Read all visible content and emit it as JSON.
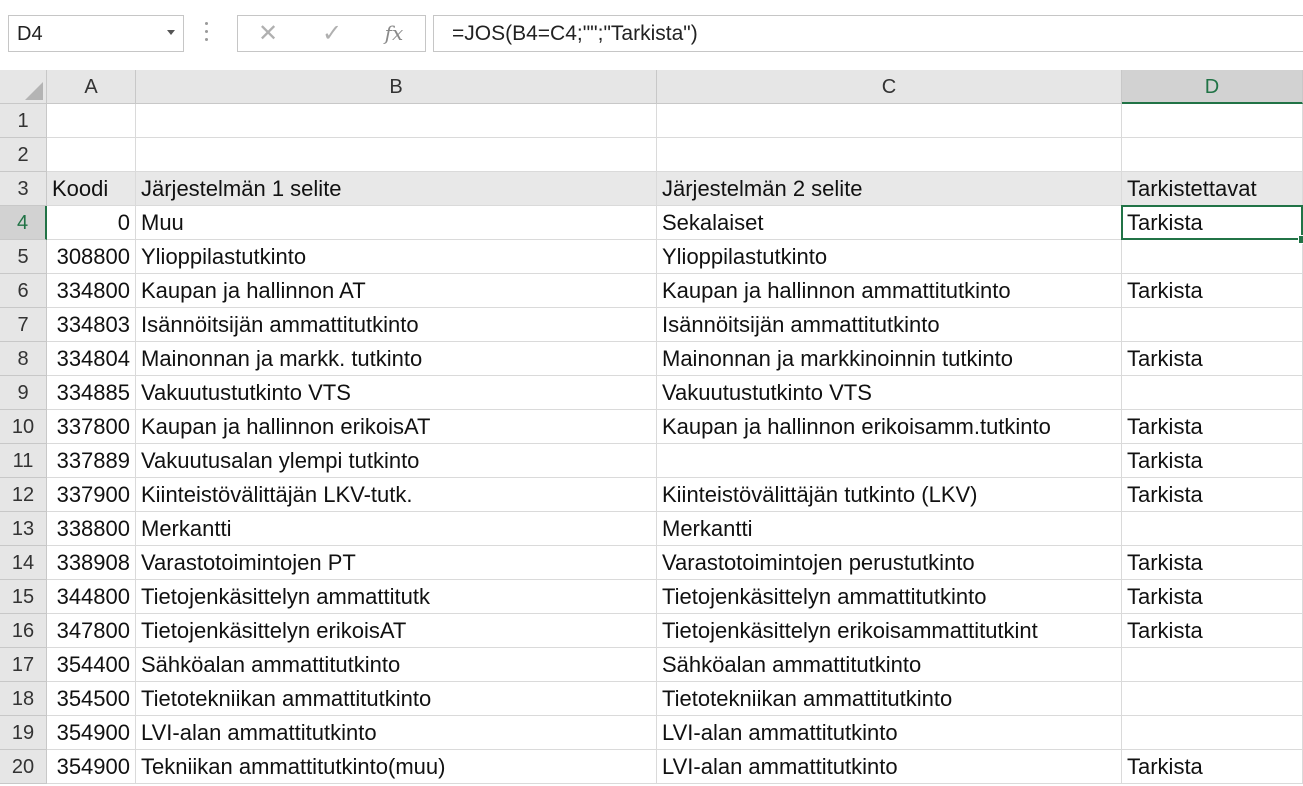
{
  "formula_bar": {
    "name_box": "D4",
    "cancel_glyph": "✕",
    "enter_glyph": "✓",
    "fx_label": "fx",
    "formula": "=JOS(B4=C4;\"\";\"Tarkista\")"
  },
  "columns": [
    "A",
    "B",
    "C",
    "D"
  ],
  "active_cell": {
    "column": "D",
    "row": 4
  },
  "rows": [
    {
      "n": "1",
      "a": "",
      "b": "",
      "c": "",
      "d": ""
    },
    {
      "n": "2",
      "a": "",
      "b": "",
      "c": "",
      "d": ""
    },
    {
      "n": "3",
      "a": "Koodi",
      "b": "Järjestelmän 1 selite",
      "c": "Järjestelmän 2 selite",
      "d": "Tarkistettavat",
      "header": true
    },
    {
      "n": "4",
      "a": "0",
      "b": "Muu",
      "c": "Sekalaiset",
      "d": "Tarkista"
    },
    {
      "n": "5",
      "a": "308800",
      "b": "Ylioppilastutkinto",
      "c": "Ylioppilastutkinto",
      "d": ""
    },
    {
      "n": "6",
      "a": "334800",
      "b": "Kaupan ja hallinnon AT",
      "c": "Kaupan ja hallinnon ammattitutkinto",
      "d": "Tarkista"
    },
    {
      "n": "7",
      "a": "334803",
      "b": "Isännöitsijän ammattitutkinto",
      "c": "Isännöitsijän ammattitutkinto",
      "d": ""
    },
    {
      "n": "8",
      "a": "334804",
      "b": "Mainonnan ja markk. tutkinto",
      "c": "Mainonnan ja markkinoinnin tutkinto",
      "d": "Tarkista"
    },
    {
      "n": "9",
      "a": "334885",
      "b": "Vakuutustutkinto VTS",
      "c": "Vakuutustutkinto VTS",
      "d": ""
    },
    {
      "n": "10",
      "a": "337800",
      "b": "Kaupan ja hallinnon erikoisAT",
      "c": "Kaupan ja hallinnon erikoisamm.tutkinto",
      "d": "Tarkista"
    },
    {
      "n": "11",
      "a": "337889",
      "b": "Vakuutusalan ylempi tutkinto",
      "c": "",
      "d": "Tarkista"
    },
    {
      "n": "12",
      "a": "337900",
      "b": "Kiinteistövälittäjän LKV-tutk.",
      "c": "Kiinteistövälittäjän tutkinto (LKV)",
      "d": "Tarkista"
    },
    {
      "n": "13",
      "a": "338800",
      "b": "Merkantti",
      "c": "Merkantti",
      "d": ""
    },
    {
      "n": "14",
      "a": "338908",
      "b": "Varastotoimintojen PT",
      "c": "Varastotoimintojen perustutkinto",
      "d": "Tarkista"
    },
    {
      "n": "15",
      "a": "344800",
      "b": "Tietojenkäsittelyn ammattitutk",
      "c": "Tietojenkäsittelyn ammattitutkinto",
      "d": "Tarkista"
    },
    {
      "n": "16",
      "a": "347800",
      "b": "Tietojenkäsittelyn erikoisAT",
      "c": "Tietojenkäsittelyn erikoisammattitutkint",
      "d": "Tarkista"
    },
    {
      "n": "17",
      "a": "354400",
      "b": "Sähköalan ammattitutkinto",
      "c": "Sähköalan ammattitutkinto",
      "d": ""
    },
    {
      "n": "18",
      "a": "354500",
      "b": "Tietotekniikan ammattitutkinto",
      "c": "Tietotekniikan ammattitutkinto",
      "d": ""
    },
    {
      "n": "19",
      "a": "354900",
      "b": "LVI-alan ammattitutkinto",
      "c": "LVI-alan ammattitutkinto",
      "d": ""
    },
    {
      "n": "20",
      "a": "354900",
      "b": "Tekniikan ammattitutkinto(muu)",
      "c": "LVI-alan ammattitutkinto",
      "d": "Tarkista"
    }
  ]
}
